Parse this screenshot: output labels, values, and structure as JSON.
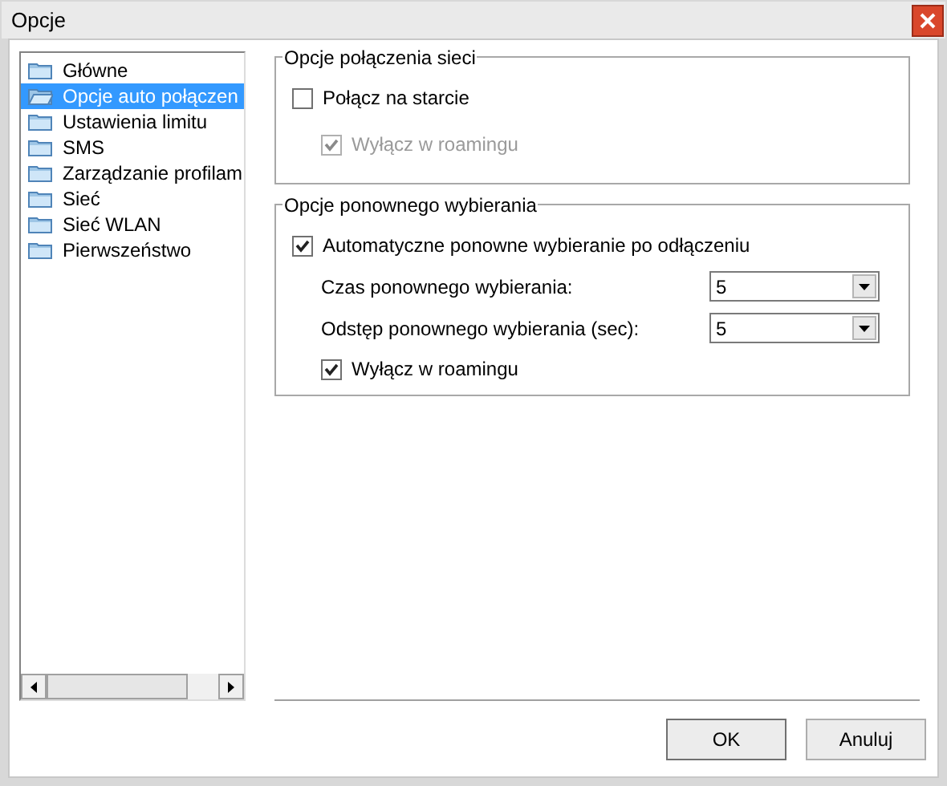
{
  "window": {
    "title": "Opcje"
  },
  "tree": {
    "items": [
      {
        "label": "Główne",
        "selected": false
      },
      {
        "label": "Opcje auto połączen",
        "selected": true
      },
      {
        "label": "Ustawienia limitu",
        "selected": false
      },
      {
        "label": "SMS",
        "selected": false
      },
      {
        "label": "Zarządzanie profilam",
        "selected": false
      },
      {
        "label": "Sieć",
        "selected": false
      },
      {
        "label": "Sieć WLAN",
        "selected": false
      },
      {
        "label": "Pierwszeństwo",
        "selected": false
      }
    ]
  },
  "groups": [
    {
      "title": "Opcje połączenia sieci",
      "rows": [
        {
          "kind": "checkbox",
          "label": "Połącz na starcie",
          "checked": false,
          "disabled": false,
          "indent": false
        },
        {
          "kind": "checkbox",
          "label": "Wyłącz w roamingu",
          "checked": true,
          "disabled": true,
          "indent": true
        }
      ]
    },
    {
      "title": "Opcje ponownego wybierania",
      "rows": [
        {
          "kind": "checkbox",
          "label": "Automatyczne ponowne wybieranie po odłączeniu",
          "checked": true,
          "disabled": false,
          "indent": false
        },
        {
          "kind": "dropdown",
          "label": "Czas ponownego wybierania:",
          "value": "5"
        },
        {
          "kind": "dropdown",
          "label": "Odstęp ponownego wybierania (sec):",
          "value": "5"
        },
        {
          "kind": "checkbox",
          "label": "Wyłącz w roamingu",
          "checked": true,
          "disabled": false,
          "indent": true
        }
      ]
    }
  ],
  "buttons": [
    "OK",
    "Anuluj"
  ]
}
